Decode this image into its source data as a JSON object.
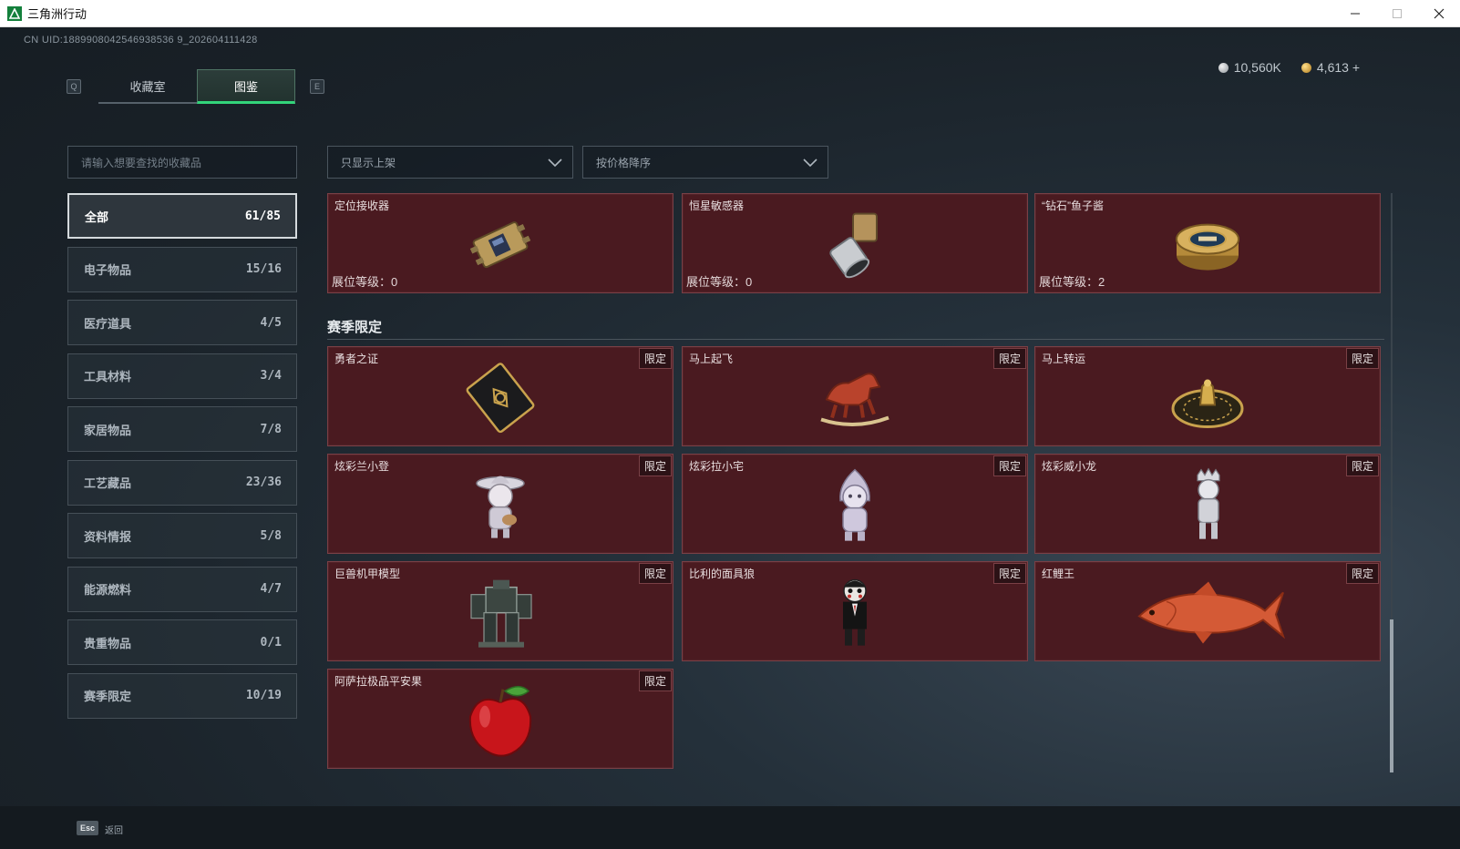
{
  "window": {
    "title": "三角洲行动",
    "controls": [
      "minimize",
      "maximize",
      "close"
    ]
  },
  "uid": "CN UID:1889908042546938536 9_202604111428",
  "tabs": {
    "prev_key": "Q",
    "next_key": "E",
    "items": [
      {
        "label": "收藏室",
        "active": false
      },
      {
        "label": "图鉴",
        "active": true
      }
    ]
  },
  "currency": {
    "silver": "10,560K",
    "gold": "4,613 +"
  },
  "search": {
    "placeholder": "请输入想要查找的收藏品"
  },
  "sidebar": {
    "items": [
      {
        "label": "全部",
        "count": "61/85",
        "active": true
      },
      {
        "label": "电子物品",
        "count": "15/16"
      },
      {
        "label": "医疗道具",
        "count": "4/5"
      },
      {
        "label": "工具材料",
        "count": "3/4"
      },
      {
        "label": "家居物品",
        "count": "7/8"
      },
      {
        "label": "工艺藏品",
        "count": "23/36"
      },
      {
        "label": "资料情报",
        "count": "5/8"
      },
      {
        "label": "能源燃料",
        "count": "4/7"
      },
      {
        "label": "贵重物品",
        "count": "0/1"
      },
      {
        "label": "赛季限定",
        "count": "10/19"
      }
    ]
  },
  "filters": {
    "shelf": "只显示上架",
    "sort": "按价格降序"
  },
  "top_items": [
    {
      "name": "定位接收器",
      "level_label": "展位等级：",
      "level": "0",
      "icon": "gold-receiver-device"
    },
    {
      "name": "恒星敏感器",
      "level_label": "展位等级：",
      "level": "0",
      "icon": "star-sensor"
    },
    {
      "name": "“钻石”鱼子酱",
      "level_label": "展位等级：",
      "level": "2",
      "icon": "caviar-tin"
    }
  ],
  "section": {
    "title": "赛季限定",
    "limited_label": "限定",
    "items": [
      {
        "name": "勇者之证",
        "icon": "card-emblem"
      },
      {
        "name": "马上起飞",
        "icon": "red-rocking-horse"
      },
      {
        "name": "马上转运",
        "icon": "golden-turntable"
      },
      {
        "name": "炫彩兰小登",
        "icon": "figure-sombrero"
      },
      {
        "name": "炫彩拉小宅",
        "icon": "figure-hood"
      },
      {
        "name": "炫彩威小龙",
        "icon": "figure-crown"
      },
      {
        "name": "巨兽机甲模型",
        "icon": "mech-model"
      },
      {
        "name": "比利的面具狼",
        "icon": "puppet-doll"
      },
      {
        "name": "红鲤王",
        "icon": "red-carp"
      },
      {
        "name": "阿萨拉极品平安果",
        "icon": "red-apple"
      }
    ]
  },
  "footer": {
    "esc_key": "Esc",
    "back_label": "返回"
  },
  "colors": {
    "card_bg": "#4a1a20",
    "card_border": "#7a4046",
    "accent_green": "#32d47a"
  }
}
